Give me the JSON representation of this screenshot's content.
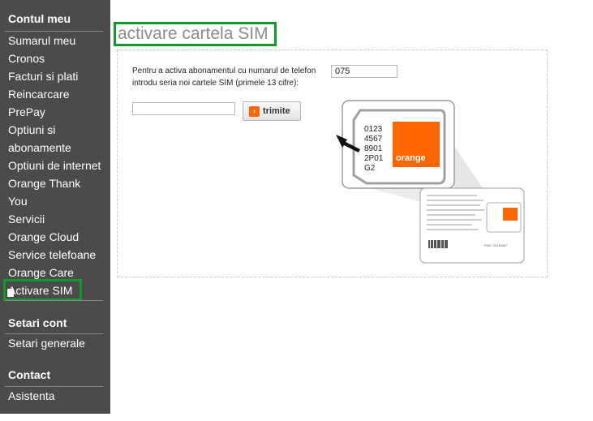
{
  "sidebar": {
    "sections": [
      {
        "title": "Contul meu",
        "items": [
          "Sumarul meu",
          "Cronos",
          "Facturi si plati",
          "Reincarcare",
          "PrePay",
          "Optiuni si",
          "abonamente",
          "Optiuni de internet",
          "Orange Thank",
          "You",
          "Servicii",
          "Orange Cloud",
          "Service telefoane",
          "Orange Care",
          "Activare SIM"
        ]
      },
      {
        "title": "Setari cont",
        "items": [
          "Setari generale"
        ]
      },
      {
        "title": "Contact",
        "items": [
          "Asistenta"
        ]
      }
    ],
    "active_item": "Activare SIM"
  },
  "main": {
    "title": "activare cartela SIM",
    "instruction_line1": "Pentru a activa abonamentul cu numarul de telefon",
    "instruction_line2": "introdu seria noi cartele SIM (primele 13 cifre):",
    "prefix_value": "075",
    "serial_value": "",
    "submit_label": "trimite",
    "submit_icon": "arrow-right-icon"
  },
  "illustration": {
    "sim_digits": [
      "0123",
      "4567",
      "8901",
      "2P01",
      "G2"
    ],
    "brand_label": "orange",
    "brand_color": "#ff6600",
    "card_footer_text": "PUK: 01234567"
  },
  "colors": {
    "sidebar_bg": "#4b4b4b",
    "highlight": "#109a2b",
    "title_gray": "#8c8c8c",
    "orange": "#ff6600"
  }
}
